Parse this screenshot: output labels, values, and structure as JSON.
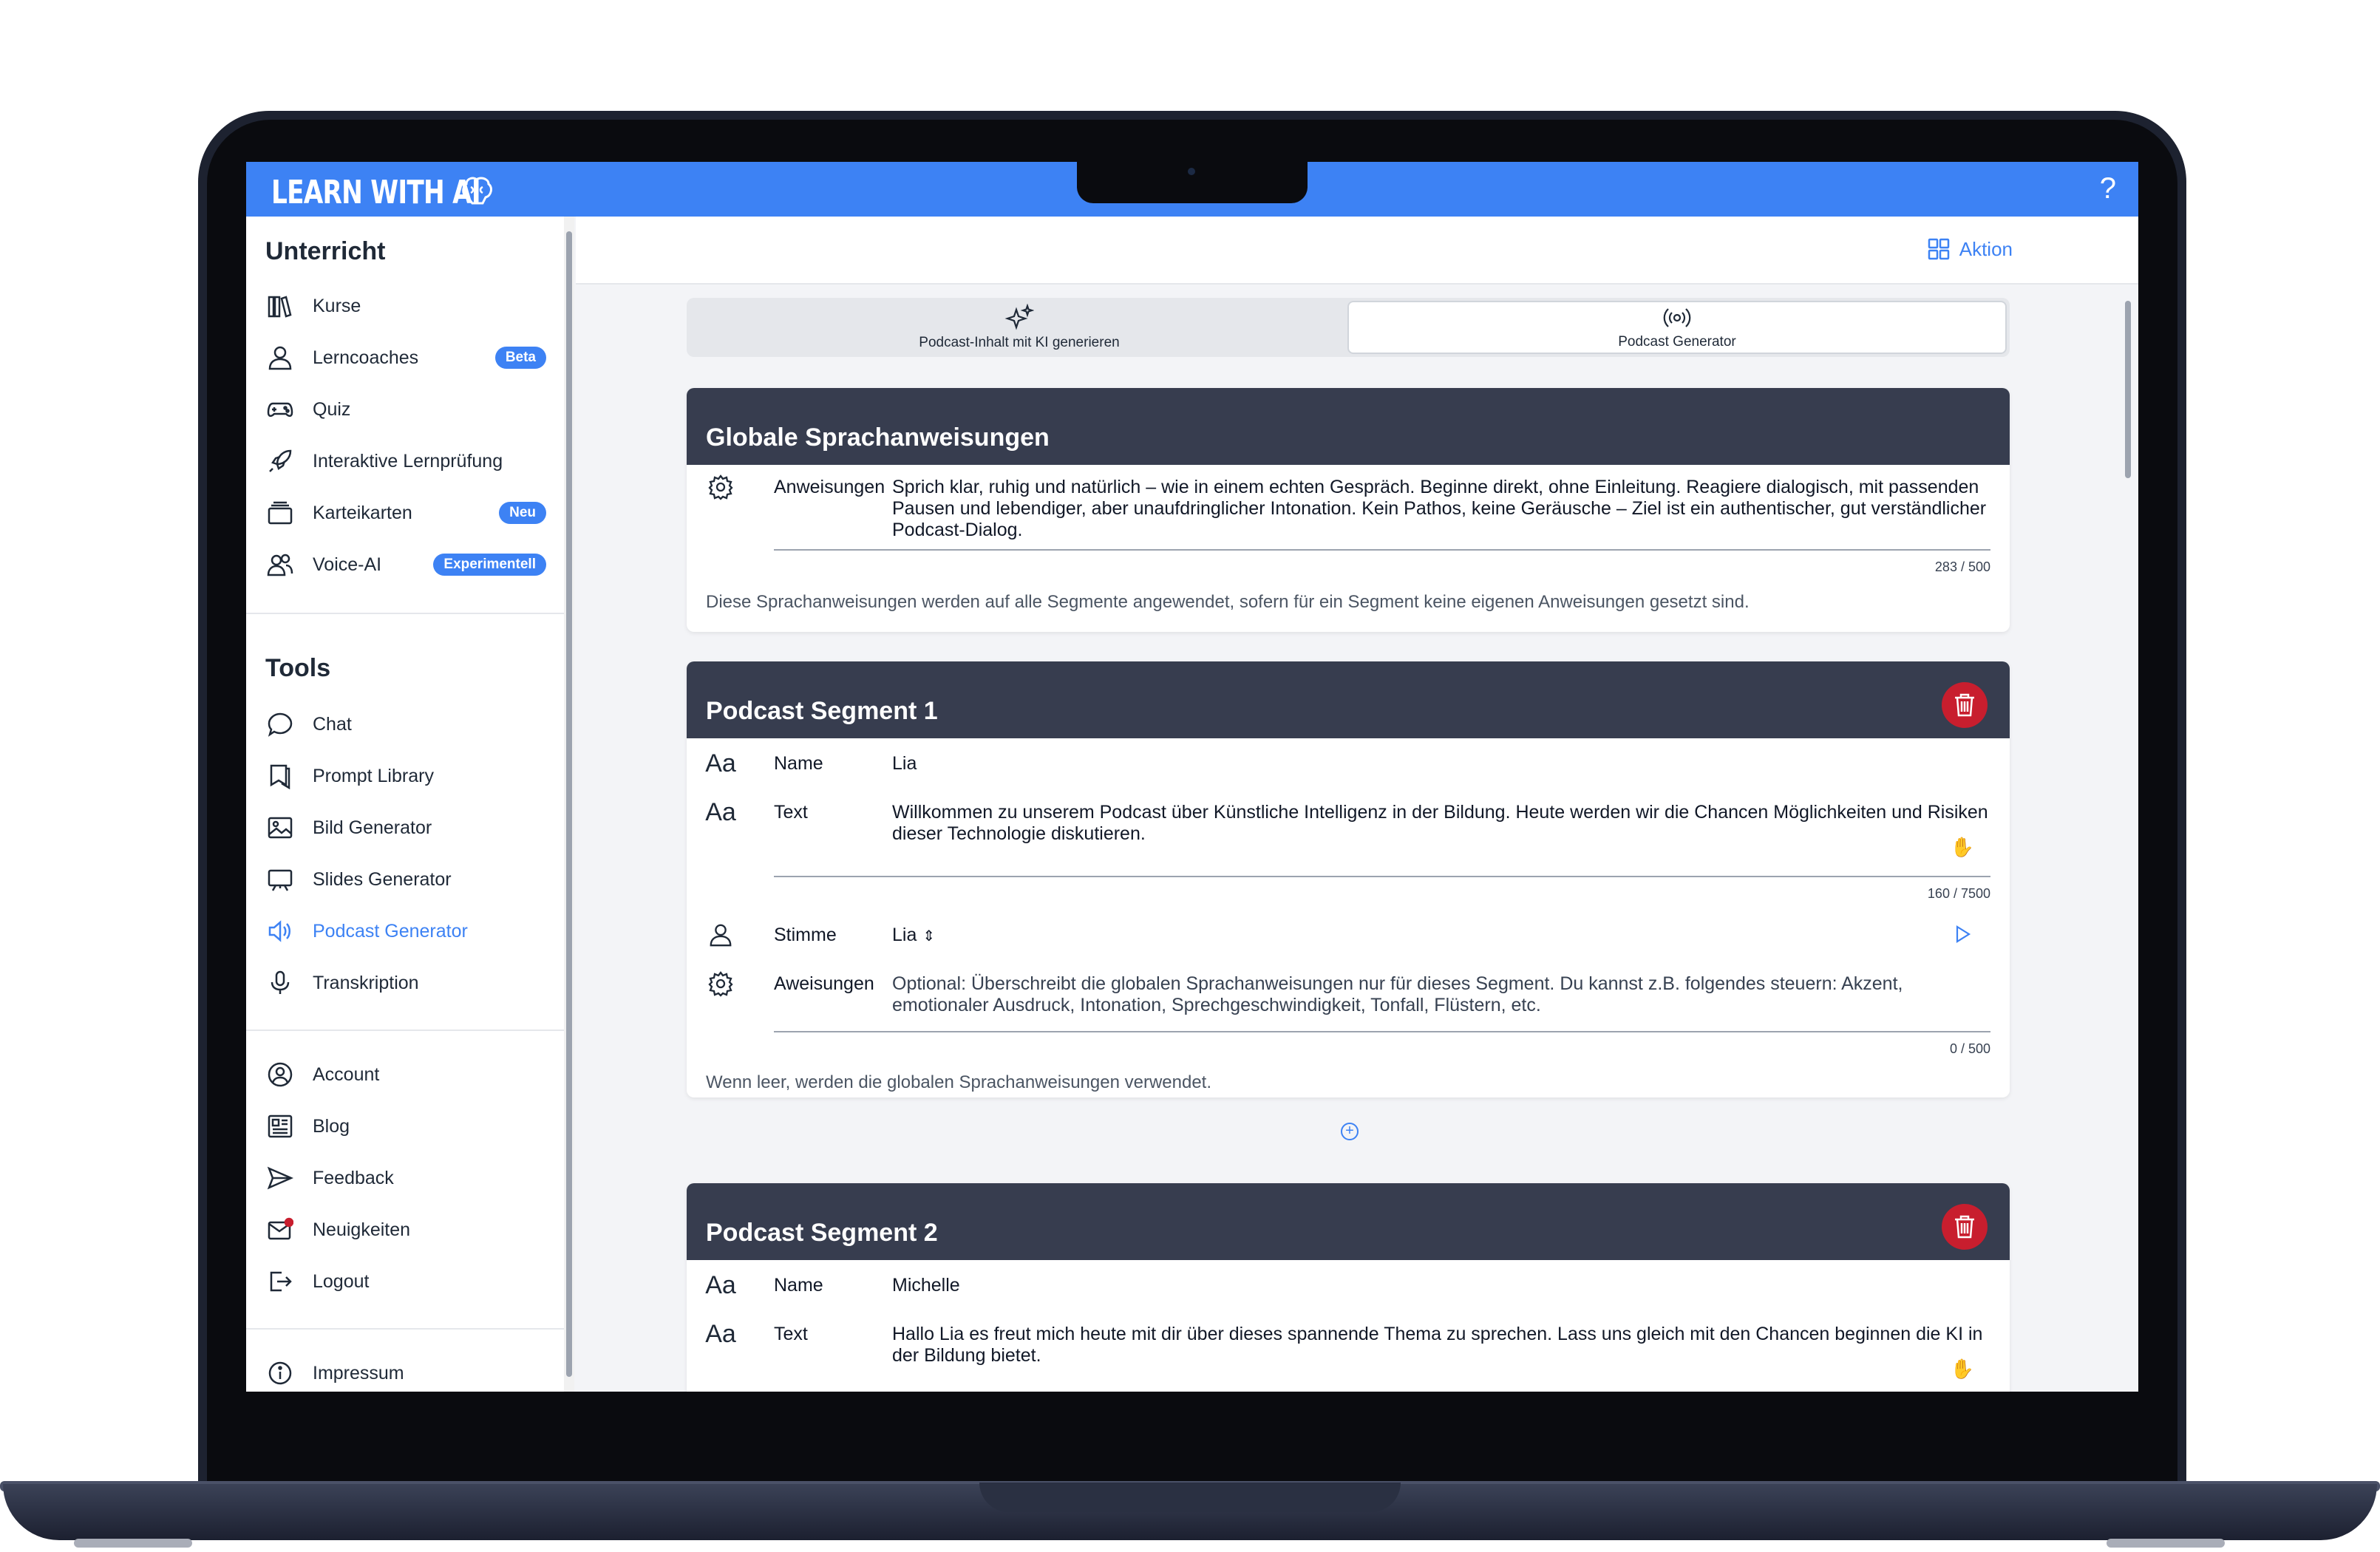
{
  "app": {
    "logo_text": "LEARN WITH AI",
    "help_label": "?"
  },
  "sidebar": {
    "sections": [
      {
        "title": "Unterricht"
      },
      {
        "title": "Tools"
      }
    ],
    "unterricht_items": [
      {
        "label": "Kurse",
        "icon": "books-icon"
      },
      {
        "label": "Lerncoaches",
        "icon": "person-icon",
        "badge": "Beta"
      },
      {
        "label": "Quiz",
        "icon": "gamepad-icon"
      },
      {
        "label": "Interaktive Lernprüfung",
        "icon": "rocket-icon"
      },
      {
        "label": "Karteikarten",
        "icon": "cards-icon",
        "badge": "Neu"
      },
      {
        "label": "Voice-AI",
        "icon": "people-icon",
        "badge": "Experimentell"
      }
    ],
    "tools_items": [
      {
        "label": "Chat",
        "icon": "chat-icon"
      },
      {
        "label": "Prompt Library",
        "icon": "bookmark-icon"
      },
      {
        "label": "Bild Generator",
        "icon": "image-icon"
      },
      {
        "label": "Slides Generator",
        "icon": "presentation-icon"
      },
      {
        "label": "Podcast Generator",
        "icon": "speaker-icon",
        "active": true
      },
      {
        "label": "Transkription",
        "icon": "microphone-icon"
      }
    ],
    "account_items": [
      {
        "label": "Account",
        "icon": "account-icon"
      },
      {
        "label": "Blog",
        "icon": "newspaper-icon"
      },
      {
        "label": "Feedback",
        "icon": "send-icon"
      },
      {
        "label": "Neuigkeiten",
        "icon": "mail-icon"
      },
      {
        "label": "Logout",
        "icon": "logout-icon"
      }
    ],
    "footer_item": {
      "label": "Impressum",
      "icon": "info-icon"
    }
  },
  "main": {
    "action_label": "Aktion",
    "tabs": [
      {
        "label": "Podcast-Inhalt mit KI generieren",
        "icon": "sparkles-icon"
      },
      {
        "label": "Podcast Generator",
        "icon": "broadcast-icon",
        "active": true
      }
    ],
    "global": {
      "title": "Globale Sprachanweisungen",
      "label": "Anweisungen",
      "value": "Sprich klar, ruhig und natürlich – wie in einem echten Gespräch. Beginne direkt, ohne Einleitung. Reagiere dialogisch, mit passenden Pausen und lebendiger, aber unaufdringlicher Intonation. Kein Pathos, keine Geräusche – Ziel ist ein authentischer, gut verständlicher Podcast-Dialog.",
      "count": "283 / 500",
      "hint": "Diese Sprachanweisungen werden auf alle Segmente angewendet, sofern für ein Segment keine eigenen Anweisungen gesetzt sind."
    },
    "segments": [
      {
        "title": "Podcast Segment 1",
        "name_label": "Name",
        "name_value": "Lia",
        "text_label": "Text",
        "text_value": "Willkommen zu unserem Podcast über Künstliche Intelligenz in der Bildung. Heute werden wir die Chancen Möglichkeiten und Risiken dieser Technologie diskutieren.",
        "text_count": "160 / 7500",
        "voice_label": "Stimme",
        "voice_value": "Lia",
        "instr_label": "Aweisungen",
        "instr_placeholder": "Optional: Überschreibt die globalen Sprachanweisungen nur für dieses Segment. Du kannst z.B. folgendes steuern: Akzent, emotionaler Ausdruck, Intonation, Sprechgeschwindigkeit, Tonfall, Flüstern, etc.",
        "instr_count": "0 / 500",
        "hint": "Wenn leer, werden die globalen Sprachanweisungen verwendet."
      },
      {
        "title": "Podcast Segment 2",
        "name_label": "Name",
        "name_value": "Michelle",
        "text_label": "Text",
        "text_value": "Hallo Lia es freut mich heute mit dir über dieses spannende Thema zu sprechen. Lass uns gleich mit den Chancen beginnen die KI in der Bildung bietet."
      }
    ],
    "text_icon": "Aa"
  },
  "colors": {
    "accent": "#3d82f4",
    "card_header": "#373d4f",
    "danger": "#c81e2e"
  }
}
